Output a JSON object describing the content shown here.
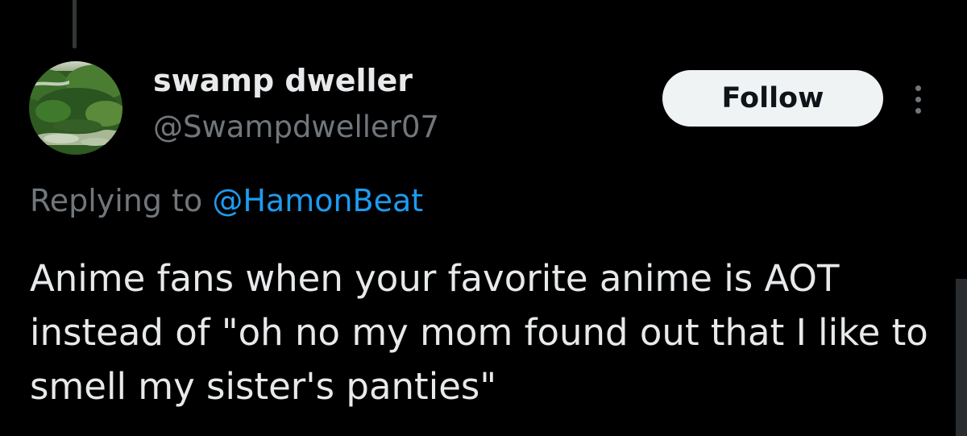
{
  "tweet": {
    "display_name": "swamp dweller",
    "handle": "@Swampdweller07",
    "follow_label": "Follow",
    "replying_prefix": "Replying to",
    "replying_handle": "@HamonBeat",
    "text": "Anime fans when your favorite anime is AOT instead of \"oh no my mom found out that I like to smell my sister's panties\""
  },
  "icons": {
    "more": "more-options-icon",
    "avatar": "avatar-swamp-photo"
  },
  "colors": {
    "background": "#000000",
    "primary_text": "#e7e9ea",
    "secondary_text": "#71767b",
    "link": "#1d9bf0",
    "follow_bg": "#eff3f4",
    "follow_text": "#0f1419"
  }
}
